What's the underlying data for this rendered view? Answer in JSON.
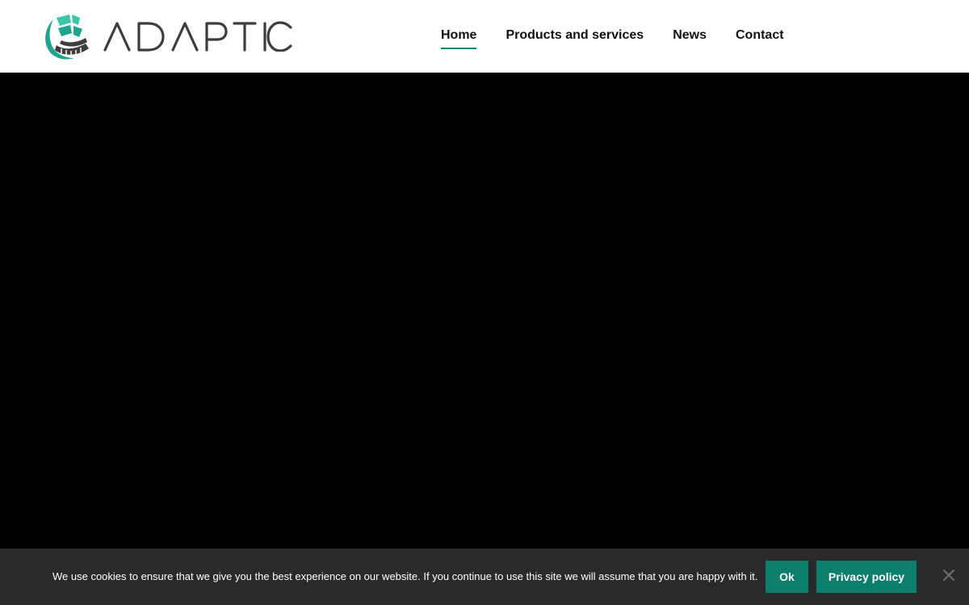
{
  "header": {
    "logo": {
      "icon": "adaptic-logo-icon",
      "wordmark": "ADAPTIC",
      "colors": {
        "teal": "#1ea58f",
        "teal_light": "#3cc6a9",
        "dark": "#3d3d3d"
      }
    },
    "nav": {
      "items": [
        {
          "label": "Home",
          "active": true
        },
        {
          "label": "Products and services",
          "active": false
        },
        {
          "label": "News",
          "active": false
        },
        {
          "label": "Contact",
          "active": false
        }
      ],
      "active_underline_color": "#108a78"
    }
  },
  "hero": {
    "background_color": "#000000"
  },
  "cookie_bar": {
    "message": "We use cookies to ensure that we give you the best experience on our website. If you continue to use this site we will assume that you are happy with it.",
    "ok_label": "Ok",
    "privacy_label": "Privacy policy",
    "close_icon": "close-icon",
    "button_color": "#0b7f6c",
    "background_color": "#2a2a2a"
  }
}
